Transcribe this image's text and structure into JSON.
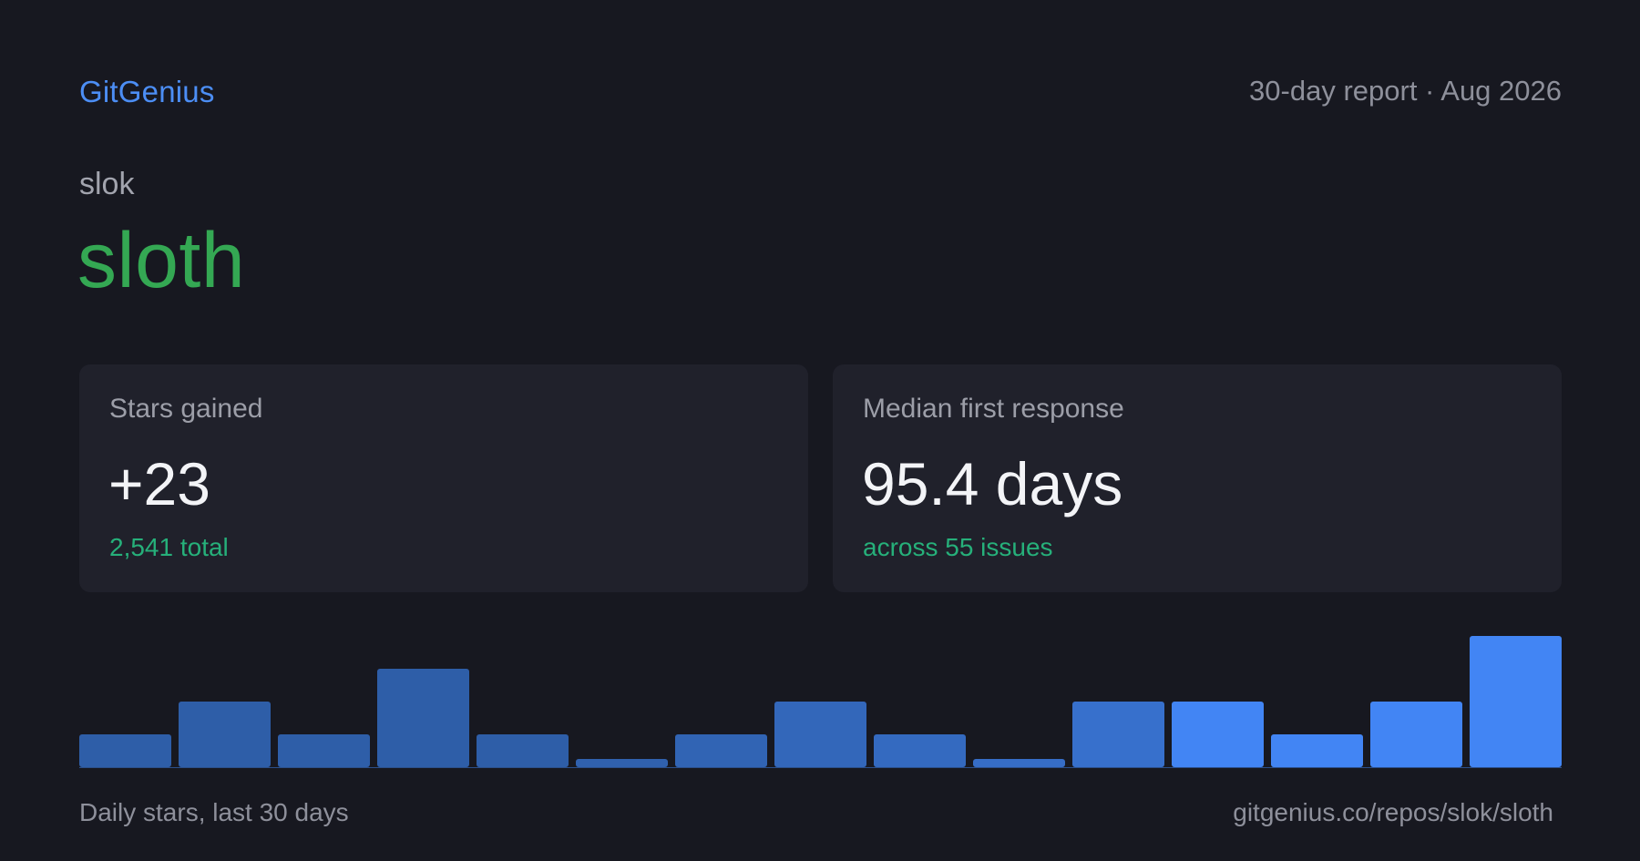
{
  "header": {
    "brand": "GitGenius",
    "report_label": "30-day report · Aug 2026"
  },
  "repo": {
    "owner": "slok",
    "name": "sloth"
  },
  "cards": {
    "stars": {
      "label": "Stars gained",
      "value": "+23",
      "sub": "2,541 total"
    },
    "response": {
      "label": "Median first response",
      "value": "95.4 days",
      "sub": "across 55 issues"
    }
  },
  "footer": {
    "caption": "Daily stars, last 30 days",
    "url": "gitgenius.co/repos/slok/sloth"
  },
  "colors": {
    "brand": "#4c8ef5",
    "repo_name": "#34a853",
    "sub_text": "#26b07a",
    "bar_dark": "#2e5ea8",
    "bar_bright": "#4285f4"
  },
  "chart_data": {
    "type": "bar",
    "values": [
      1,
      2,
      1,
      3,
      1,
      0.25,
      1,
      2,
      1,
      0.25,
      2,
      2,
      1,
      2,
      4
    ],
    "ylim": [
      0,
      4
    ],
    "grid": false,
    "legend": "none"
  }
}
